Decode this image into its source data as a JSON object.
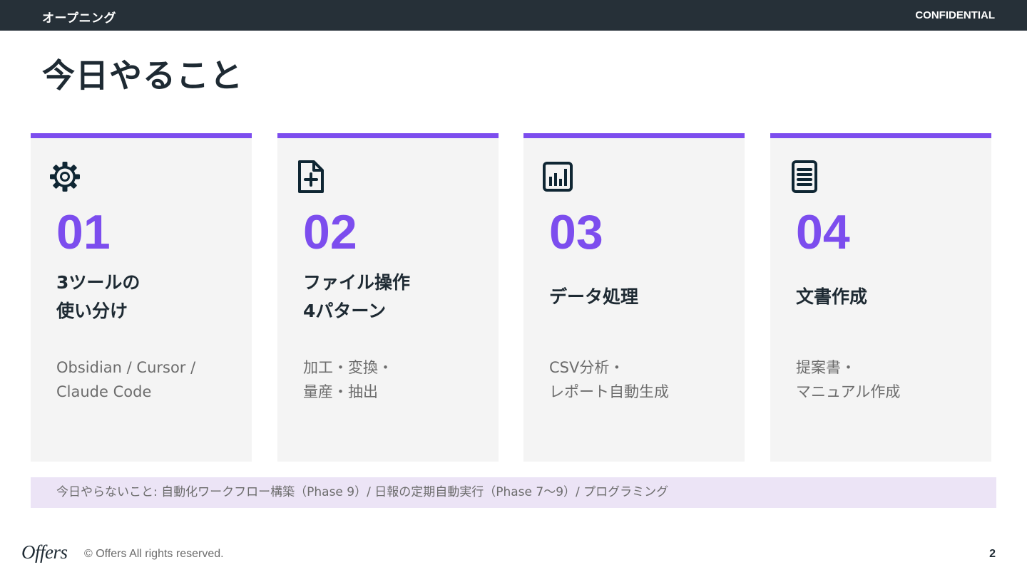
{
  "header": {
    "section": "オープニング",
    "confidential": "CONFIDENTIAL"
  },
  "title": "今日やること",
  "cards": [
    {
      "icon": "gear-icon",
      "number": "01",
      "heading_lines": [
        "3ツールの",
        "使い分け"
      ],
      "desc_lines": [
        "Obsidian / Cursor /",
        "Claude Code"
      ]
    },
    {
      "icon": "file-plus-icon",
      "number": "02",
      "heading_lines": [
        "ファイル操作",
        "4パターン"
      ],
      "desc_lines": [
        "加工・変換・",
        "量産・抽出"
      ]
    },
    {
      "icon": "bar-chart-icon",
      "number": "03",
      "heading_lines": [
        "データ処理"
      ],
      "desc_lines": [
        "CSV分析・",
        "レポート自動生成"
      ]
    },
    {
      "icon": "document-icon",
      "number": "04",
      "heading_lines": [
        "文書作成"
      ],
      "desc_lines": [
        "提案書・",
        "マニュアル作成"
      ]
    }
  ],
  "note": "今日やらないこと: 自動化ワークフロー構築（Phase 9）/ 日報の定期自動実行（Phase 7〜9）/ プログラミング",
  "footer": {
    "logo": "Offers",
    "copyright": "© Offers All rights reserved.",
    "page_number": "2"
  },
  "colors": {
    "accent": "#7c4dee",
    "header_bg": "#263038",
    "text_dark": "#1e2a33",
    "note_bg": "#ece4f6",
    "card_bg": "#f4f4f4"
  }
}
